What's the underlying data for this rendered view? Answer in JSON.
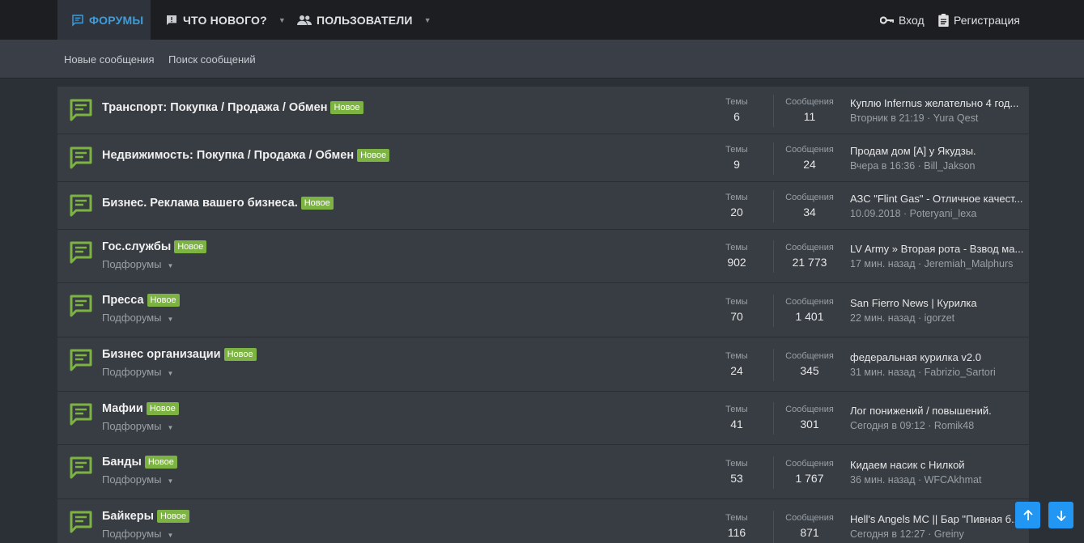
{
  "nav": {
    "forums": "ФОРУМЫ",
    "whats_new": "ЧТО НОВОГО?",
    "users": "ПОЛЬЗОВАТЕЛИ",
    "login": "Вход",
    "register": "Регистрация"
  },
  "subnav": {
    "new_posts": "Новые сообщения",
    "search_posts": "Поиск сообщений"
  },
  "labels": {
    "threads": "Темы",
    "messages": "Сообщения",
    "subforums": "Подфорумы",
    "new_badge": "Новое"
  },
  "colors": {
    "accent": "#3d9cdb",
    "icon_green": "#7cb342",
    "fab_blue": "#2196f3"
  },
  "forums": [
    {
      "title": "Транспорт: Покупка / Продажа / Обмен",
      "threads": "6",
      "messages": "11",
      "last_title": "Куплю Infernus желательно 4 год...",
      "last_meta": "Вторник в 21:19 · Yura Qest",
      "subforums": false
    },
    {
      "title": "Недвижимость: Покупка / Продажа / Обмен",
      "threads": "9",
      "messages": "24",
      "last_title": "Продам дом [A] у Якудзы.",
      "last_meta": "Вчера в 16:36 · Bill_Jakson",
      "subforums": false
    },
    {
      "title": "Бизнес. Реклама вашего бизнеса.",
      "threads": "20",
      "messages": "34",
      "last_title": "АЗС \"Flint Gas\" - Отличное качест...",
      "last_meta": "10.09.2018 · Poteryani_lexa",
      "subforums": false
    },
    {
      "title": "Гос.службы",
      "threads": "902",
      "messages": "21 773",
      "last_title": "LV Army » Вторая рота - Взвод ма...",
      "last_meta": "17 мин. назад · Jeremiah_Malphurs",
      "subforums": true
    },
    {
      "title": "Пресса",
      "threads": "70",
      "messages": "1 401",
      "last_title": "San Fierro News | Курилка",
      "last_meta": "22 мин. назад · igorzet",
      "subforums": true
    },
    {
      "title": "Бизнес организации",
      "threads": "24",
      "messages": "345",
      "last_title": "федеральная курилка v2.0",
      "last_meta": "31 мин. назад · Fabrizio_Sartori",
      "subforums": true
    },
    {
      "title": "Мафии",
      "threads": "41",
      "messages": "301",
      "last_title": "Лог понижений / повышений.",
      "last_meta": "Сегодня в 09:12 · Romik48",
      "subforums": true
    },
    {
      "title": "Банды",
      "threads": "53",
      "messages": "1 767",
      "last_title": "Кидаем насик с Нилкой",
      "last_meta": "36 мин. назад · WFCAkhmat",
      "subforums": true
    },
    {
      "title": "Байкеры",
      "threads": "116",
      "messages": "871",
      "last_title": "Hell's Angels MC || Бар \"Пивная б...",
      "last_meta": "Сегодня в 12:27 · Greiny",
      "subforums": true
    }
  ]
}
